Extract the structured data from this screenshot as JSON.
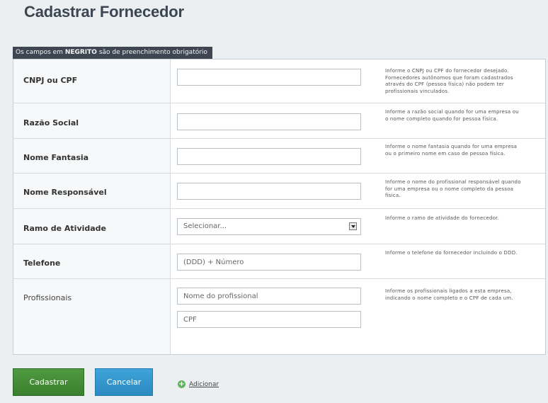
{
  "page": {
    "title": "Cadastrar Fornecedor"
  },
  "notice": {
    "prefix": "Os campos em ",
    "bold": "NEGRITO",
    "suffix": " são de preenchimento obrigatório"
  },
  "fields": {
    "cnpj": {
      "label": "CNPJ ou CPF",
      "value": "",
      "placeholder": "",
      "hint": "Informe o CNPJ ou CPF do fornecedor desejado. Fornecedores autônomos que foram cadastrados através do CPF (pessoa física) não podem ter profissionais vinculados."
    },
    "razao_social": {
      "label": "Razão Social",
      "value": "",
      "placeholder": "",
      "hint": "Informe a razão social quando for uma empresa ou o nome completo quando for pessoa física."
    },
    "nome_fantasia": {
      "label": "Nome Fantasia",
      "value": "",
      "placeholder": "",
      "hint": "Informe o nome fantasia quando for uma empresa ou o primeiro nome em caso de pessoa física."
    },
    "nome_responsavel": {
      "label": "Nome Responsável",
      "value": "",
      "placeholder": "",
      "hint": "Informe o nome do profissional responsável quando for uma empresa ou o nome completo da pessoa física."
    },
    "ramo_atividade": {
      "label": "Ramo de Atividade",
      "selected": "Selecionar...",
      "hint": "Informe o ramo de atividade do fornecedor."
    },
    "telefone": {
      "label": "Telefone",
      "value": "",
      "placeholder": "(DDD) + Número",
      "hint": "Informe o telefone do fornecedor incluindo o DDD."
    },
    "profissionais": {
      "label": "Profissionais",
      "nome_placeholder": "Nome do profissional",
      "cpf_placeholder": "CPF",
      "add_label": "Adicionar",
      "hint": "Informe os profissionais ligados a esta empresa, indicando o nome completo e o CPF de cada um."
    }
  },
  "buttons": {
    "submit": "Cadastrar",
    "cancel": "Cancelar"
  },
  "colors": {
    "submit": "#3f8a33",
    "cancel": "#2f92c9",
    "notice_bg": "#3d4651"
  }
}
